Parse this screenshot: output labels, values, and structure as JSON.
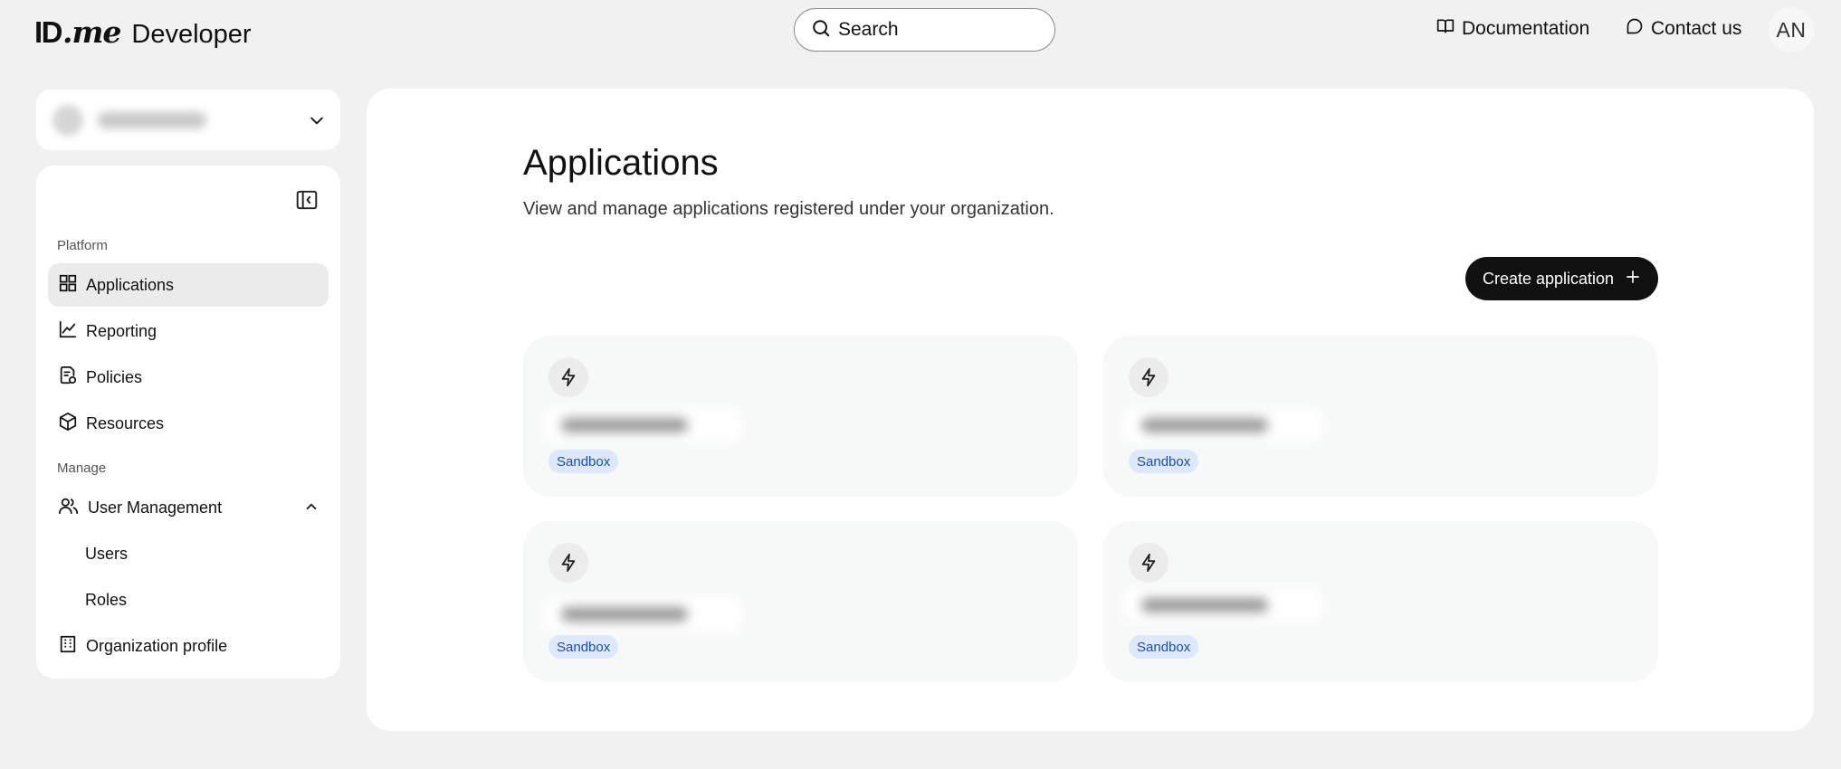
{
  "header": {
    "logo_id": "ID",
    "logo_me": ".me",
    "logo_product": "Developer",
    "search_placeholder": "Search",
    "documentation_label": "Documentation",
    "contact_label": "Contact us",
    "avatar_initials": "AN"
  },
  "sidebar": {
    "platform_label": "Platform",
    "manage_label": "Manage",
    "items": {
      "applications": "Applications",
      "reporting": "Reporting",
      "policies": "Policies",
      "resources": "Resources",
      "user_management": "User Management",
      "users": "Users",
      "roles": "Roles",
      "organization_profile": "Organization profile"
    }
  },
  "main": {
    "title": "Applications",
    "description": "View and manage applications registered under your organization.",
    "create_button_label": "Create application",
    "applications": [
      {
        "environment": "Sandbox"
      },
      {
        "environment": "Sandbox"
      },
      {
        "environment": "Sandbox"
      },
      {
        "environment": "Sandbox"
      }
    ]
  },
  "icons": {
    "search": "search-icon",
    "documentation": "book-icon",
    "contact": "chat-icon",
    "collapse": "sidebar-collapse-icon",
    "applications": "grid-icon",
    "reporting": "chart-line-icon",
    "policies": "policy-document-icon",
    "resources": "cube-icon",
    "user_management": "users-icon",
    "organization_profile": "building-icon",
    "app": "lightning-icon",
    "create": "plus-icon"
  },
  "colors": {
    "accent": "#111111",
    "badge_bg": "#dde8fb",
    "badge_text": "#1f4fa6",
    "active_nav_bg": "#ebebeb"
  }
}
